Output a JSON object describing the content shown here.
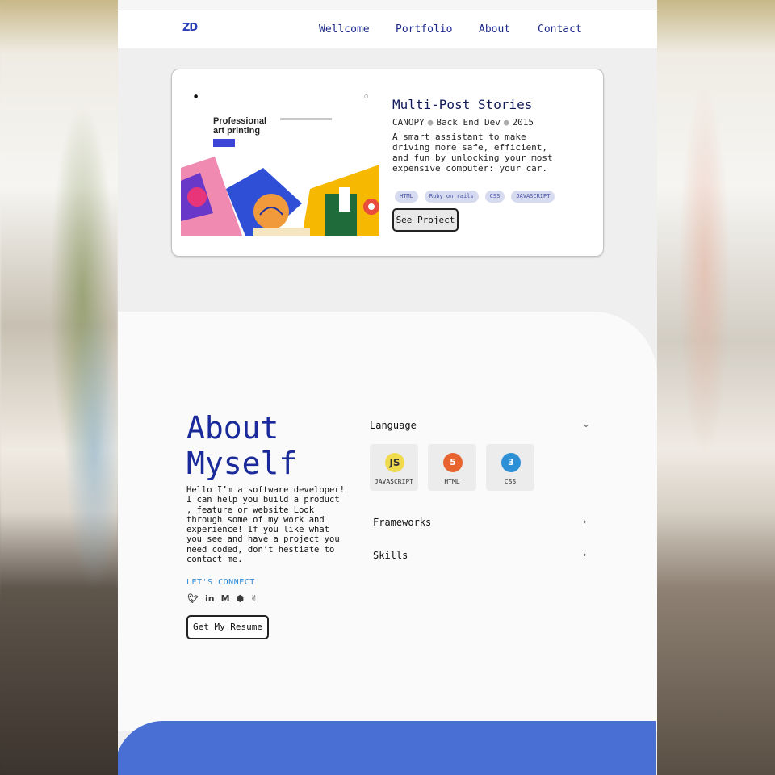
{
  "nav": {
    "logo": "ZD",
    "links": [
      "Wellcome",
      "Portfolio",
      "About",
      "Contact"
    ]
  },
  "project": {
    "title": "Multi-Post Stories",
    "company": "CANOPY",
    "role": "Back End Dev",
    "year": "2015",
    "description": "A smart assistant to make driving more safe, efficient, and fun by unlocking your most expensive computer: your car.",
    "tags": [
      "HTML",
      "Ruby on rails",
      "CSS",
      "JAVASCRIPT"
    ],
    "button": "See Project",
    "thumbnail": {
      "headline": "Professional art printing"
    }
  },
  "about": {
    "title_line1": "About",
    "title_line2": "Myself",
    "text": "Hello I’m a software developer! I can help you build a product , feature or website Look through some of my work and experience! If you like what you see and have a project you need coded, don’t hestiate to contact me.",
    "connect_label": "LET'S CONNECT",
    "socials": [
      "twitter-icon",
      "linkedin-icon",
      "medium-icon",
      "github-icon",
      "angellist-icon"
    ],
    "resume_button": "Get My Resume"
  },
  "skills": {
    "language_label": "Language",
    "languages": [
      {
        "icon_text": "JS",
        "label": "JAVASCRIPT",
        "color": "#f0db4f"
      },
      {
        "icon_text": "5",
        "label": "HTML",
        "color": "#e8642f"
      },
      {
        "icon_text": "3",
        "label": "CSS",
        "color": "#2d8fd6"
      }
    ],
    "frameworks_label": "Frameworks",
    "skills_label": "Skills"
  },
  "colors": {
    "accent": "#1a2a9a",
    "blue_section": "#4a6fd4",
    "tag_bg": "#d7dbef"
  }
}
